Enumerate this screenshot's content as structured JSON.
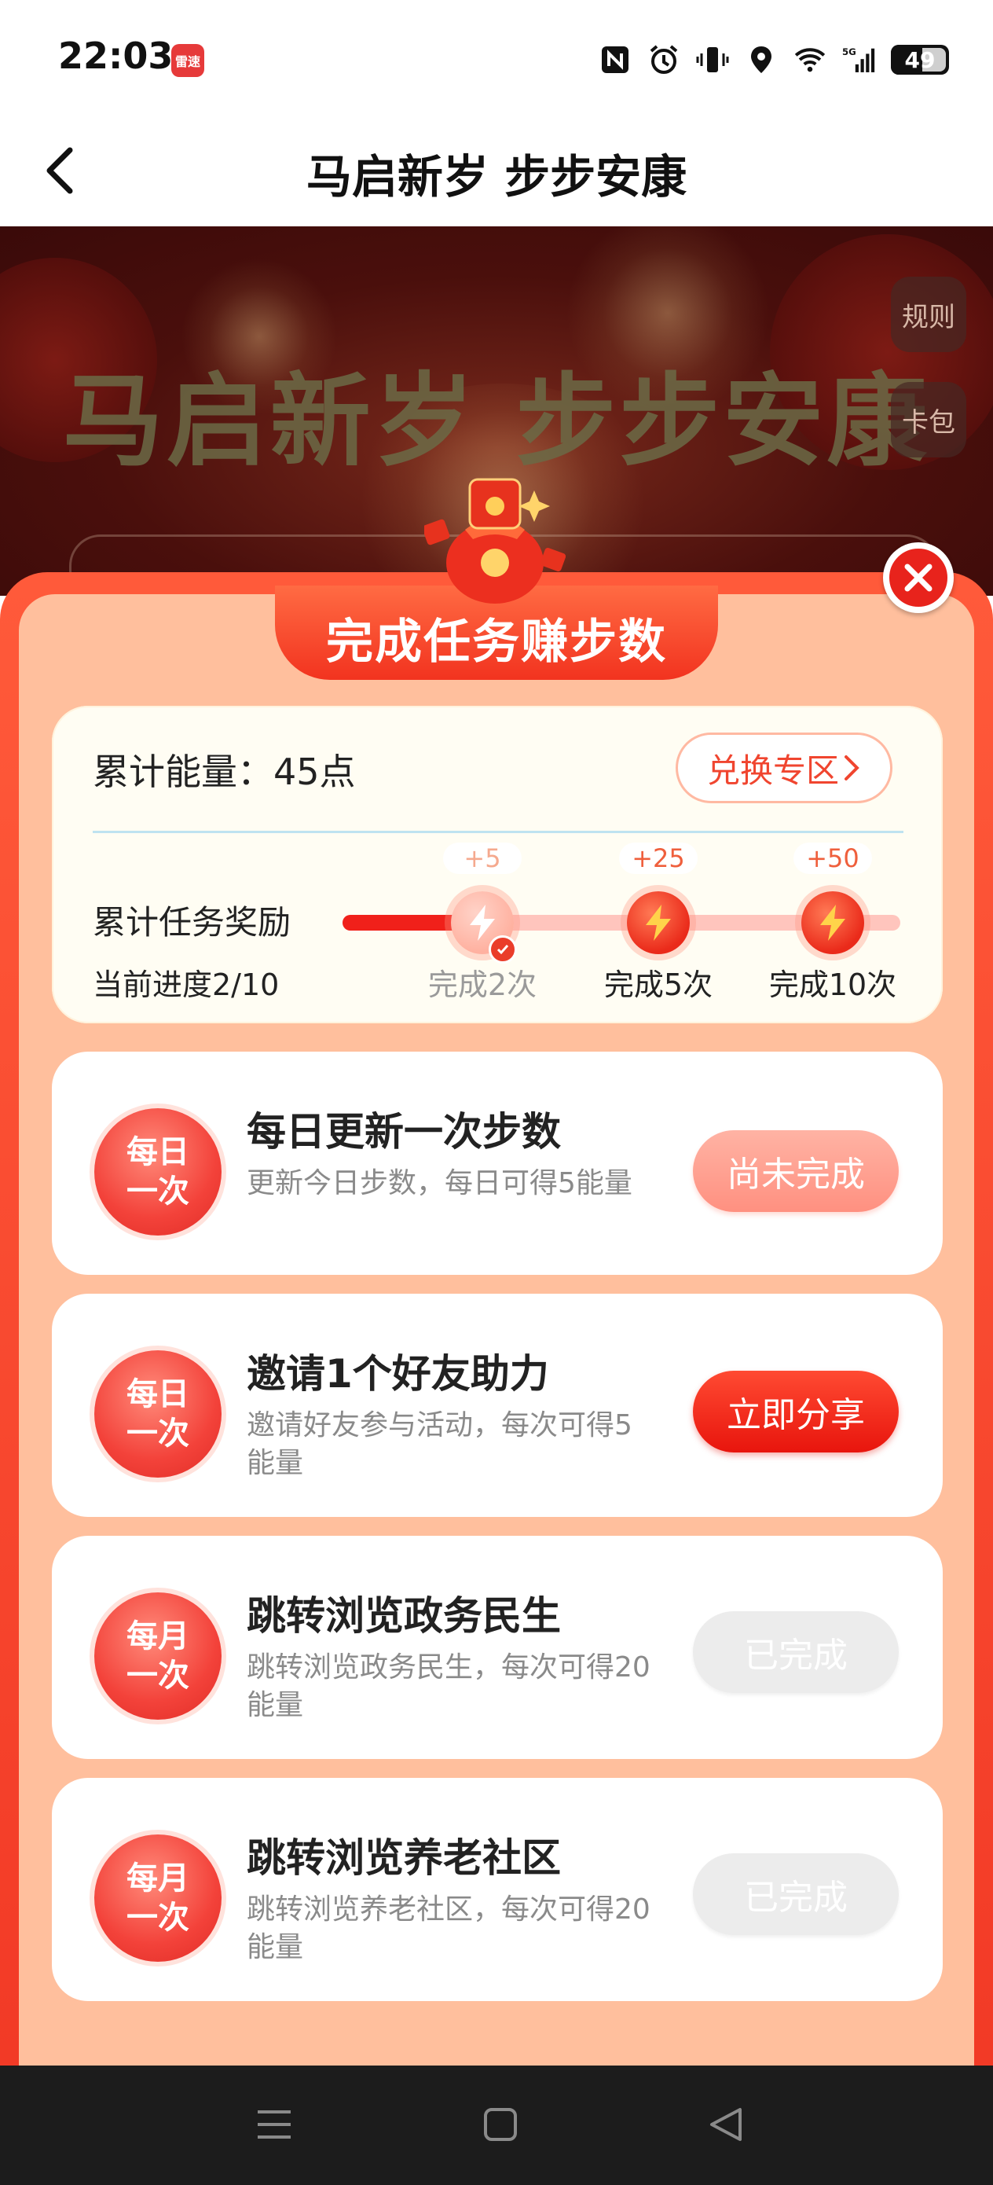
{
  "status_bar": {
    "time": "22:03",
    "app_icon_text": "雷速",
    "battery": "49",
    "icons": [
      "nfc-icon",
      "alarm-icon",
      "vibrate-icon",
      "location-icon",
      "wifi-icon",
      "signal-5g-icon",
      "battery-icon"
    ]
  },
  "header": {
    "title": "马启新岁 步步安康",
    "back_icon": "chevron-left-icon"
  },
  "banner": {
    "title": "马启新岁 步步安康",
    "rules_label": "规则",
    "card_pack_label": "卡包"
  },
  "modal": {
    "title": "完成任务赚步数",
    "close_icon": "close-icon"
  },
  "energy": {
    "accumulated_label": "累计能量：45点",
    "exchange_label": "兑换专区",
    "reward_label": "累计任务奖励",
    "progress_label": "当前进度2/10",
    "progress_value": 0.2,
    "milestones": [
      {
        "bonus": "+5",
        "label": "完成2次",
        "state": "completed"
      },
      {
        "bonus": "+25",
        "label": "完成5次",
        "state": "locked"
      },
      {
        "bonus": "+50",
        "label": "完成10次",
        "state": "locked"
      }
    ]
  },
  "tasks": [
    {
      "badge_line1": "每日",
      "badge_line2": "一次",
      "title": "每日更新一次步数",
      "desc": "更新今日步数，每日可得5能量",
      "button": "尚未完成",
      "state": "pending"
    },
    {
      "badge_line1": "每日",
      "badge_line2": "一次",
      "title": "邀请1个好友助力",
      "desc": "邀请好友参与活动，每次可得5能量",
      "button": "立即分享",
      "state": "action"
    },
    {
      "badge_line1": "每月",
      "badge_line2": "一次",
      "title": "跳转浏览政务民生",
      "desc": "跳转浏览政务民生，每次可得20能量",
      "button": "已完成",
      "state": "done"
    },
    {
      "badge_line1": "每月",
      "badge_line2": "一次",
      "title": "跳转浏览养老社区",
      "desc": "跳转浏览养老社区，每次可得20能量",
      "button": "已完成",
      "state": "done"
    }
  ],
  "colors": {
    "accent": "#f0201a",
    "panel": "#ffbf9d",
    "modal_border": "#f23a26"
  },
  "nav": {
    "icons": [
      "menu-icon",
      "home-icon",
      "back-triangle-icon"
    ]
  }
}
